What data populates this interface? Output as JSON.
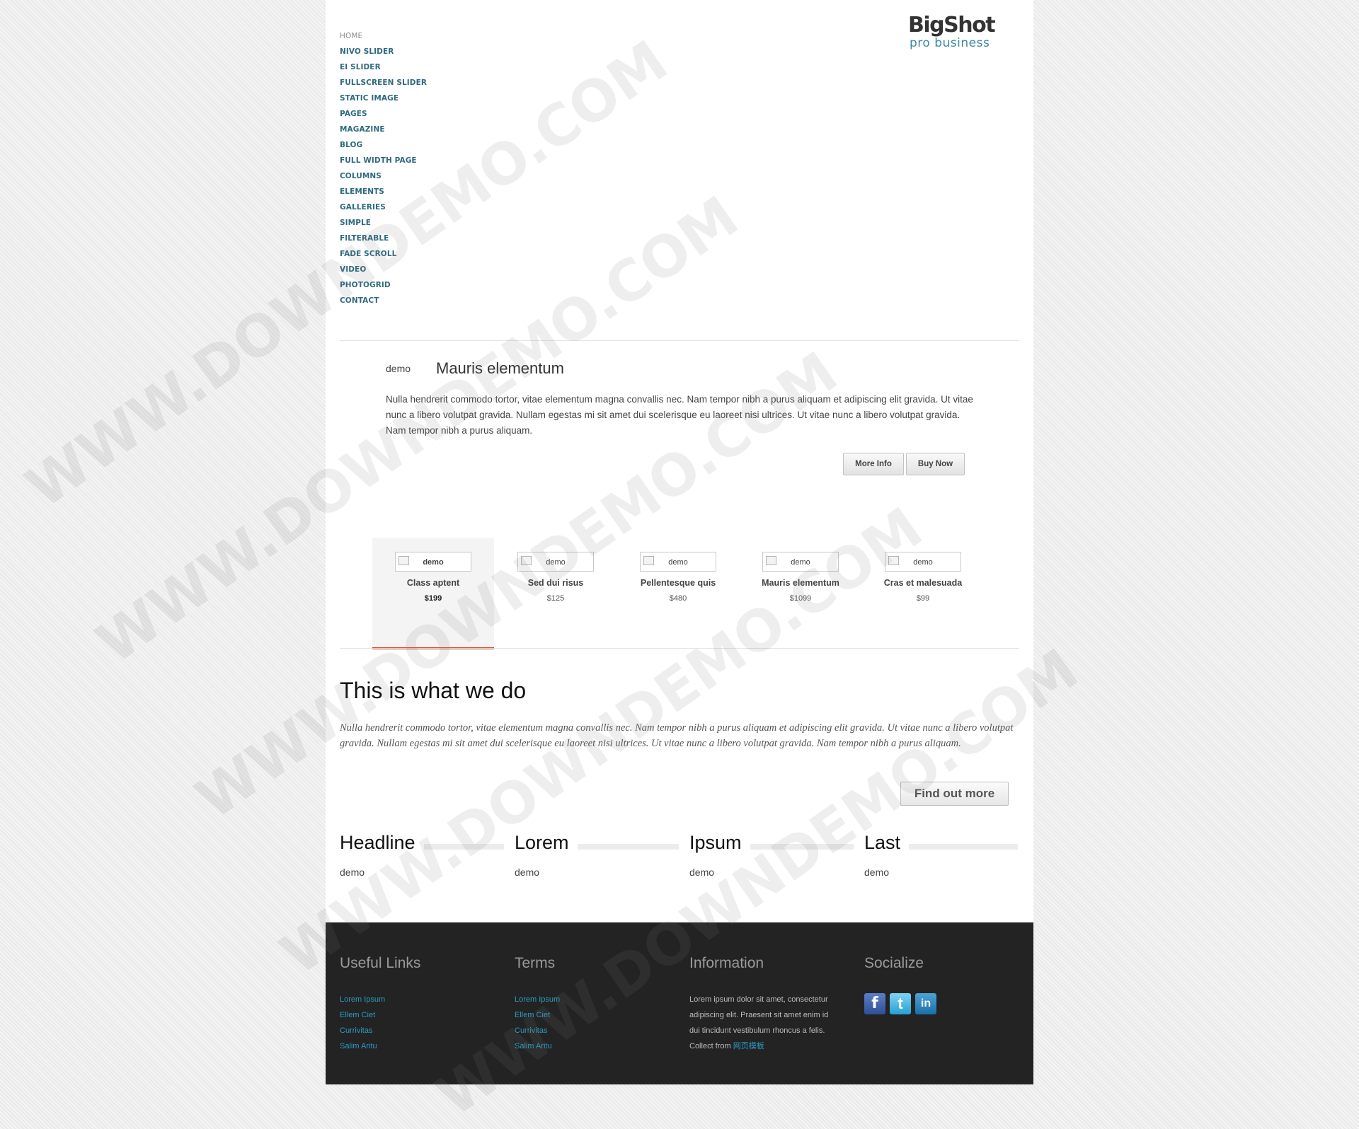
{
  "brand": {
    "name": "BigShot",
    "tagline": "pro business"
  },
  "nav": [
    "HOME",
    "NIVO SLIDER",
    "EI SLIDER",
    "FULLSCREEN SLIDER",
    "STATIC IMAGE",
    "PAGES",
    "MAGAZINE",
    "BLOG",
    "FULL WIDTH PAGE",
    "COLUMNS",
    "ELEMENTS",
    "GALLERIES",
    "SIMPLE",
    "FILTERABLE",
    "FADE SCROLL",
    "VIDEO",
    "PHOTOGRID",
    "CONTACT"
  ],
  "feature": {
    "image_alt": "demo",
    "title": "Mauris elementum",
    "text": "Nulla hendrerit commodo tortor, vitae elementum magna convallis nec. Nam tempor nibh a purus aliquam et adipiscing elit gravida. Ut vitae nunc a libero volutpat gravida. Nullam egestas mi sit amet dui scelerisque eu laoreet nisi ultrices. Ut vitae nunc a libero volutpat gravida. Nam tempor nibh a purus aliquam.",
    "more_info_label": "More Info",
    "buy_now_label": "Buy Now"
  },
  "products": [
    {
      "image_alt": "demo",
      "name": "Class aptent",
      "price": "$199",
      "selected": true
    },
    {
      "image_alt": "demo",
      "name": "Sed dui risus",
      "price": "$125"
    },
    {
      "image_alt": "demo",
      "name": "Pellentesque quis",
      "price": "$480"
    },
    {
      "image_alt": "demo",
      "name": "Mauris elementum",
      "price": "$1099"
    },
    {
      "image_alt": "demo",
      "name": "Cras et malesuada",
      "price": "$99"
    }
  ],
  "what_we_do": {
    "title": "This is what we do",
    "text": "Nulla hendrerit commodo tortor, vitae elementum magna convallis nec. Nam tempor nibh a purus aliquam et adipiscing elit gravida. Ut vitae nunc a libero volutpat gravida. Nullam egestas mi sit amet dui scelerisque eu laoreet nisi ultrices. Ut vitae nunc a libero volutpat gravida. Nam tempor nibh a purus aliquam.",
    "button_label": "Find out more"
  },
  "columns": [
    {
      "title": "Headline",
      "image_alt": "demo"
    },
    {
      "title": "Lorem",
      "image_alt": "demo"
    },
    {
      "title": "Ipsum",
      "image_alt": "demo"
    },
    {
      "title": "Last",
      "image_alt": "demo"
    }
  ],
  "footer": {
    "useful_links": {
      "title": "Useful Links",
      "items": [
        "Lorem Ipsum",
        "Ellem Ciet",
        "Currivitas",
        "Salim Aritu"
      ]
    },
    "terms": {
      "title": "Terms",
      "items": [
        "Lorem Ipsum",
        "Ellem Ciet",
        "Currivitas",
        "Salim Aritu"
      ]
    },
    "information": {
      "title": "Information",
      "lines": [
        "Lorem ipsum dolor sit amet, consectetur",
        "adipiscing elit. Praesent sit amet enim id",
        "dui tincidunt vestibulum rhoncus a felis."
      ],
      "collect_from": "Collect from",
      "collect_link": "网页模板"
    },
    "socialize": {
      "title": "Socialize",
      "icons": [
        "facebook-icon",
        "twitter-icon",
        "linkedin-icon"
      ],
      "glyphs": [
        "f",
        "t",
        "in"
      ]
    }
  },
  "watermark": "WWW.DOWNDEMO.COM",
  "colors": {
    "accent": "#d8502a",
    "nav": "#2f6a80",
    "link": "#2b9bc3",
    "footer_bg": "#232323"
  }
}
